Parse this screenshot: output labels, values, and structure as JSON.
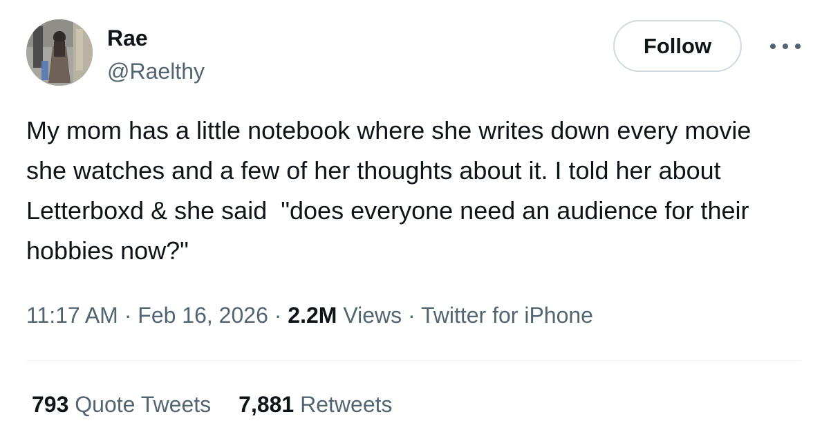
{
  "author": {
    "name": "Rae",
    "handle": "@Raelthy"
  },
  "follow_label": "Follow",
  "more_icon": "more-horizontal-icon",
  "tweet": {
    "text": "My mom has a little notebook where she writes down every movie she watches and a few of her thoughts about it. I told her about Letterboxd & she said  \"does everyone need an audience for their hobbies now?\""
  },
  "meta": {
    "time": "11:17 AM",
    "date": "Feb 16, 2026",
    "separator": " · ",
    "views_count": "2.2M",
    "views_label": "Views",
    "source": "Twitter for iPhone"
  },
  "stats": {
    "quote_tweets_count": "793",
    "quote_tweets_label": "Quote Tweets",
    "retweets_count": "7,881",
    "retweets_label": "Retweets"
  },
  "colors": {
    "text_primary": "#0f1419",
    "text_secondary": "#536471",
    "border": "#cfd9de",
    "divider": "#eff3f4"
  }
}
